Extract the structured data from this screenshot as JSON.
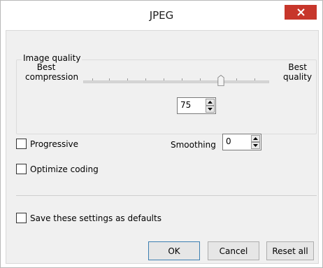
{
  "window": {
    "title": "JPEG"
  },
  "icons": {
    "close": "close-icon",
    "spin_up": "arrow-up-icon",
    "spin_down": "arrow-down-icon"
  },
  "image_quality": {
    "group_label": "Image quality",
    "left_label_line1": "Best",
    "left_label_line2": "compression",
    "right_label_line1": "Best",
    "right_label_line2": "quality",
    "slider_fraction": 0.75,
    "value": "75"
  },
  "options": {
    "progressive_label": "Progressive",
    "progressive_checked": false,
    "optimize_label": "Optimize coding",
    "optimize_checked": false,
    "smoothing_label": "Smoothing",
    "smoothing_value": "0"
  },
  "defaults": {
    "label": "Save these settings as defaults",
    "checked": false
  },
  "buttons": {
    "ok": "OK",
    "cancel": "Cancel",
    "reset": "Reset all"
  },
  "colors": {
    "close_bg": "#c7362b",
    "ok_border": "#3c7fb1",
    "dialog_bg": "#f0f0f0"
  }
}
